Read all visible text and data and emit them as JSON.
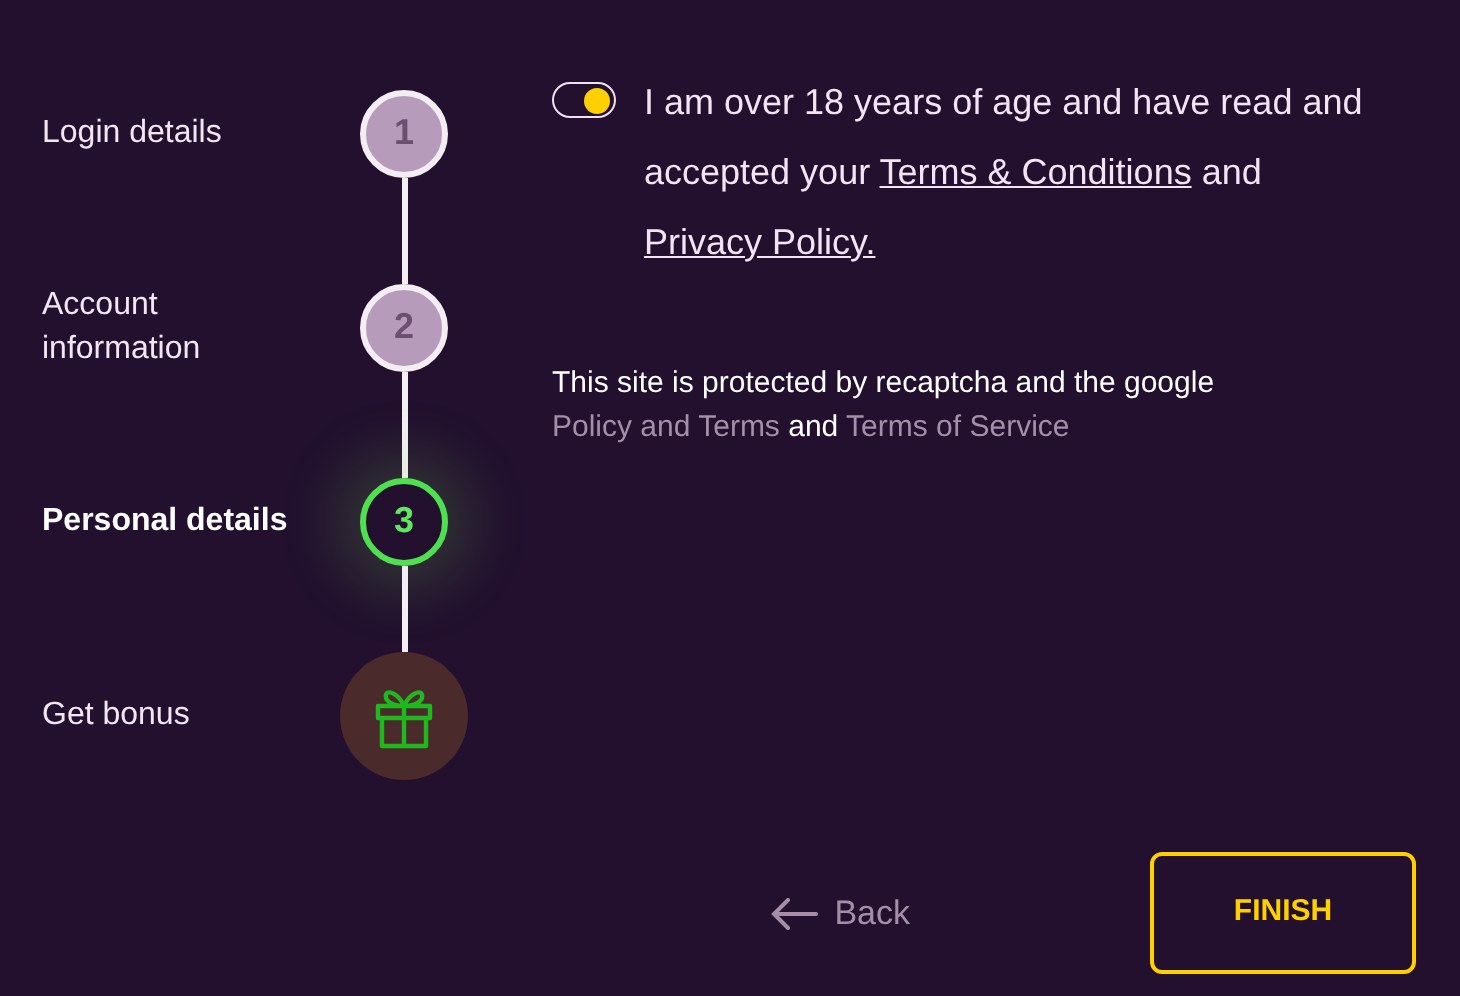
{
  "steps": [
    {
      "label": "Login details",
      "kind": "number",
      "number": "1",
      "selected": false
    },
    {
      "label": "Account information",
      "kind": "number",
      "number": "2",
      "selected": false
    },
    {
      "label": "Personal details",
      "kind": "number",
      "number": "3",
      "selected": true
    },
    {
      "label": "Get bonus",
      "kind": "gift",
      "selected": false
    }
  ],
  "consent": {
    "on": true,
    "parts": [
      {
        "kind": "text",
        "text": "I am over 18 years of age and have read and accepted your"
      },
      {
        "kind": "link",
        "text": "Terms & Conditions"
      },
      {
        "kind": "text",
        "text": "and"
      },
      {
        "kind": "link",
        "text": "Privacy Policy."
      }
    ]
  },
  "recaptcha": {
    "parts": [
      {
        "kind": "text",
        "text": "This site is protected by recaptcha and the google"
      },
      {
        "kind": "link",
        "text": "Policy and Terms"
      },
      {
        "kind": "text",
        "text": "and"
      },
      {
        "kind": "link",
        "text": "Terms of Service"
      }
    ]
  },
  "back": "Back",
  "finish": "FINISH"
}
